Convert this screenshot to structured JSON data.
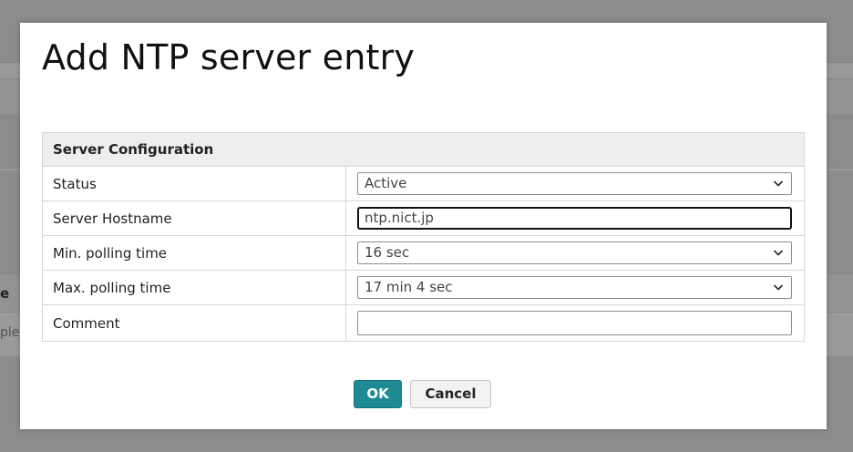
{
  "dialog": {
    "title": "Add NTP server entry"
  },
  "section": {
    "header": "Server Configuration"
  },
  "rows": [
    {
      "label": "Status",
      "value": "Active"
    },
    {
      "label": "Server Hostname",
      "value": "ntp.nict.jp"
    },
    {
      "label": "Min. polling time",
      "value": "16 sec"
    },
    {
      "label": "Max. polling time",
      "value": "17 min 4 sec"
    },
    {
      "label": "Comment",
      "value": ""
    }
  ],
  "buttons": {
    "ok_label": "OK",
    "cancel_label": "Cancel"
  },
  "background": {
    "fragment_1": "e",
    "fragment_2": "ple"
  },
  "colors": {
    "accent": "#1e8a93",
    "overlay": "#8c8c8c"
  },
  "icons": {
    "dropdown": "chevron-down-icon"
  }
}
